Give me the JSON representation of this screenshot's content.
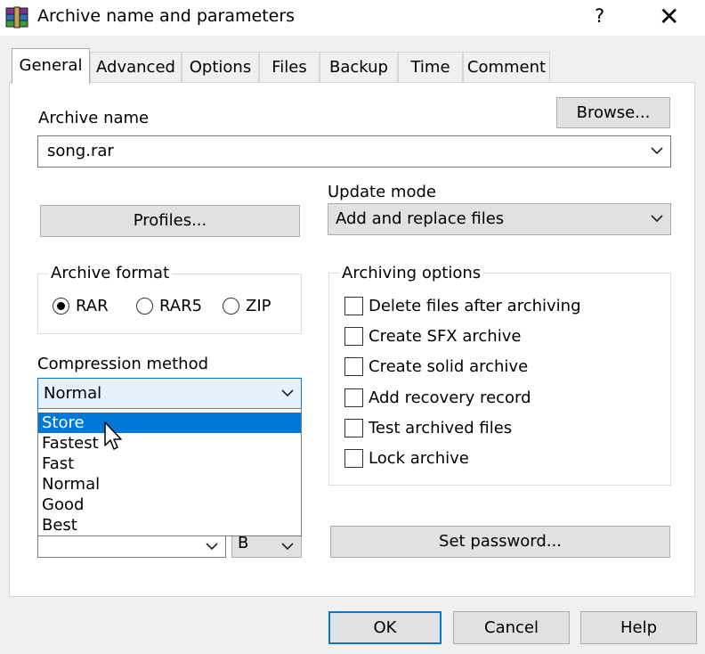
{
  "window": {
    "title": "Archive name and parameters",
    "help_glyph": "?",
    "close_glyph": "✕",
    "icon": "winrar-books-icon"
  },
  "tabs": [
    {
      "label": "General",
      "active": true
    },
    {
      "label": "Advanced"
    },
    {
      "label": "Options"
    },
    {
      "label": "Files"
    },
    {
      "label": "Backup"
    },
    {
      "label": "Time"
    },
    {
      "label": "Comment"
    }
  ],
  "archive_name": {
    "label": "Archive name",
    "value": "song.rar",
    "browse_label": "Browse..."
  },
  "profiles_label": "Profiles...",
  "update_mode": {
    "label": "Update mode",
    "value": "Add and replace files"
  },
  "archive_format": {
    "label": "Archive format",
    "options": [
      "RAR",
      "RAR5",
      "ZIP"
    ],
    "selected": "RAR"
  },
  "compression": {
    "label": "Compression method",
    "value": "Normal",
    "options": [
      "Store",
      "Fastest",
      "Fast",
      "Normal",
      "Good",
      "Best"
    ],
    "highlighted": "Store"
  },
  "split_unit": {
    "value": "B"
  },
  "archiving_options": {
    "label": "Archiving options",
    "items": [
      {
        "label": "Delete files after archiving",
        "checked": false
      },
      {
        "label": "Create SFX archive",
        "checked": false
      },
      {
        "label": "Create solid archive",
        "checked": false
      },
      {
        "label": "Add recovery record",
        "checked": false
      },
      {
        "label": "Test archived files",
        "checked": false
      },
      {
        "label": "Lock archive",
        "checked": false
      }
    ]
  },
  "set_password_label": "Set password...",
  "footer": {
    "ok": "OK",
    "cancel": "Cancel",
    "help": "Help"
  },
  "colors": {
    "accent": "#0078d7",
    "window_bg": "#f0f0f0",
    "panel_bg": "#ffffff"
  }
}
